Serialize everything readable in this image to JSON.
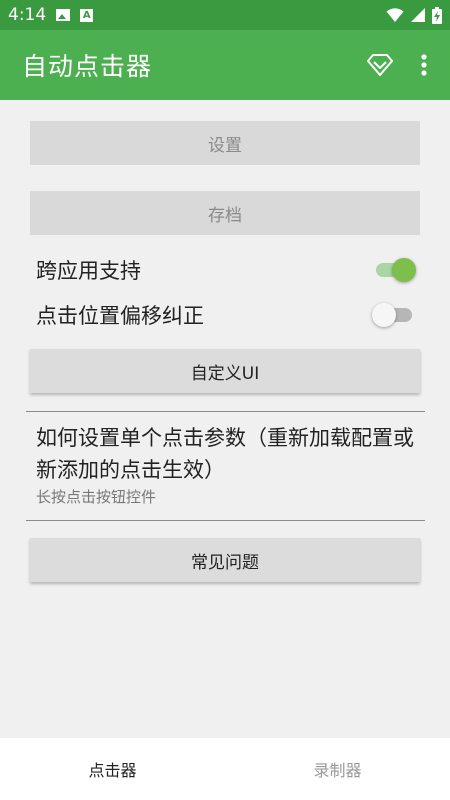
{
  "status_bar": {
    "time": "4:14",
    "icons": [
      "image-icon",
      "a-icon",
      "wifi-icon",
      "signal-icon",
      "battery-charging-icon"
    ]
  },
  "app_bar": {
    "title": "自动点击器",
    "actions": [
      "diamond-icon",
      "more-vert-icon"
    ]
  },
  "main": {
    "settings_button": "设置",
    "archive_button": "存档",
    "cross_app_label": "跨应用支持",
    "cross_app_enabled": true,
    "offset_label": "点击位置偏移纠正",
    "offset_enabled": false,
    "custom_ui_button": "自定义UI",
    "info_title": "如何设置单个点击参数（重新加载配置或新添加的点击生效）",
    "info_subtitle": "长按点击按钮控件",
    "faq_button": "常见问题"
  },
  "bottom_nav": {
    "tabs": [
      {
        "label": "点击器",
        "active": true
      },
      {
        "label": "录制器",
        "active": false
      }
    ]
  },
  "colors": {
    "status_bar": "#3a9a40",
    "app_bar": "#4caf50",
    "switch_on": "#7cc04b"
  }
}
